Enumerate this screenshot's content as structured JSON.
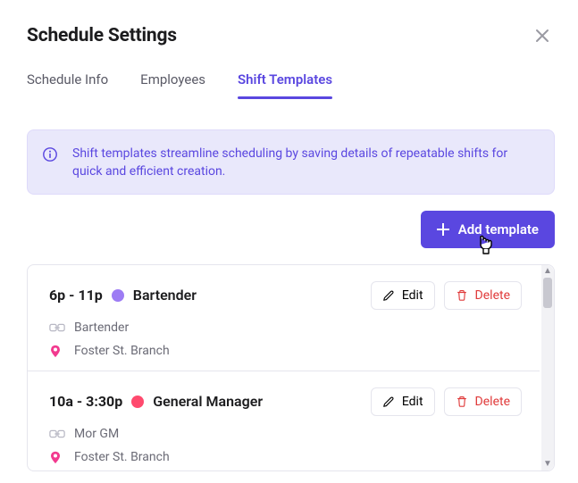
{
  "header": {
    "title": "Schedule Settings"
  },
  "tabs": [
    {
      "label": "Schedule Info",
      "active": false
    },
    {
      "label": "Employees",
      "active": false
    },
    {
      "label": "Shift Templates",
      "active": true
    }
  ],
  "info_banner": {
    "text": "Shift templates streamline scheduling by saving details of repeatable shifts for quick and efficient creation."
  },
  "add_button": {
    "label": "Add template"
  },
  "buttons": {
    "edit": "Edit",
    "delete": "Delete"
  },
  "colors": {
    "bartender_dot": "#9d7cf4",
    "gm_dot": "#ff4a6e"
  },
  "templates": [
    {
      "time": "6p - 11p",
      "role": "Bartender",
      "dot_color_key": "bartender_dot",
      "chain_label": "Bartender",
      "location": "Foster St. Branch"
    },
    {
      "time": "10a - 3:30p",
      "role": "General Manager",
      "dot_color_key": "gm_dot",
      "chain_label": "Mor GM",
      "location": "Foster St. Branch"
    }
  ]
}
